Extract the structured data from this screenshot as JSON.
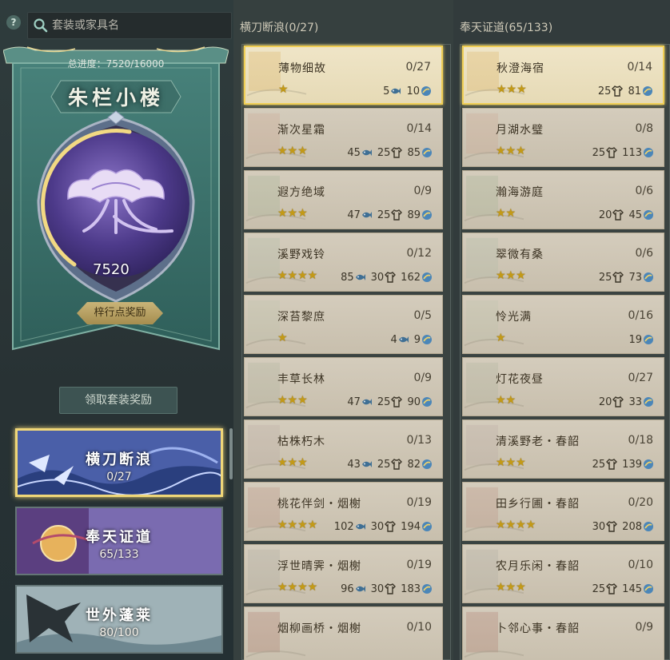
{
  "search": {
    "placeholder": "套装或家具名"
  },
  "pavilion": {
    "progress_text": "总进度：7520/16000",
    "title": "朱栏小楼",
    "score": "7520",
    "reward_label": "梓行点奖励",
    "progress_fraction": 0.47
  },
  "collect_button": "领取套装奖励",
  "sets": [
    {
      "name": "横刀断浪",
      "count": "0/27",
      "active": true
    },
    {
      "name": "奉天证道",
      "count": "65/133",
      "active": false
    },
    {
      "name": "世外蓬莱",
      "count": "80/100",
      "active": false
    }
  ],
  "columns": [
    {
      "header": "横刀断浪(0/27)",
      "items": [
        {
          "name": "薄物细故",
          "count": "0/27",
          "stars": "★",
          "s1": "5",
          "s2": "",
          "s3": "10",
          "selected": true
        },
        {
          "name": "渐次星霜",
          "count": "0/14",
          "stars": "★★★",
          "s1": "45",
          "s2": "25",
          "s3": "85"
        },
        {
          "name": "遐方绝域",
          "count": "0/9",
          "stars": "★★★",
          "s1": "47",
          "s2": "25",
          "s3": "89"
        },
        {
          "name": "溪野戏铃",
          "count": "0/12",
          "stars": "★★★★",
          "s1": "85",
          "s2": "30",
          "s3": "162"
        },
        {
          "name": "深苔黎庶",
          "count": "0/5",
          "stars": "★",
          "s1": "4",
          "s2": "",
          "s3": "9"
        },
        {
          "name": "丰草长林",
          "count": "0/9",
          "stars": "★★★",
          "s1": "47",
          "s2": "25",
          "s3": "90"
        },
        {
          "name": "枯株朽木",
          "count": "0/13",
          "stars": "★★★",
          "s1": "43",
          "s2": "25",
          "s3": "82"
        },
        {
          "name": "桃花伴剑・烟榭",
          "count": "0/19",
          "stars": "★★★★",
          "s1": "102",
          "s2": "30",
          "s3": "194"
        },
        {
          "name": "浮世晴霁・烟榭",
          "count": "0/19",
          "stars": "★★★★",
          "s1": "96",
          "s2": "30",
          "s3": "183"
        },
        {
          "name": "烟柳画桥・烟榭",
          "count": "0/10",
          "stars": "",
          "s1": "",
          "s2": "",
          "s3": ""
        }
      ]
    },
    {
      "header": "奉天证道(65/133)",
      "items": [
        {
          "name": "秋澄海宿",
          "count": "0/14",
          "stars": "★★★",
          "s1": "",
          "s2": "25",
          "s3": "81",
          "selected": true
        },
        {
          "name": "月湖水璧",
          "count": "0/8",
          "stars": "★★★",
          "s1": "",
          "s2": "25",
          "s3": "113"
        },
        {
          "name": "瀚海游庭",
          "count": "0/6",
          "stars": "★★",
          "s1": "",
          "s2": "20",
          "s3": "45"
        },
        {
          "name": "翠微有桑",
          "count": "0/6",
          "stars": "★★★",
          "s1": "",
          "s2": "25",
          "s3": "73"
        },
        {
          "name": "怜光满",
          "count": "0/16",
          "stars": "★",
          "s1": "",
          "s2": "",
          "s3": "19"
        },
        {
          "name": "灯花夜昼",
          "count": "0/27",
          "stars": "★★",
          "s1": "",
          "s2": "20",
          "s3": "33"
        },
        {
          "name": "清溪野老・春韶",
          "count": "0/18",
          "stars": "★★★",
          "s1": "",
          "s2": "25",
          "s3": "139"
        },
        {
          "name": "田乡行圃・春韶",
          "count": "0/20",
          "stars": "★★★★",
          "s1": "",
          "s2": "30",
          "s3": "208"
        },
        {
          "name": "农月乐闲・春韶",
          "count": "0/10",
          "stars": "★★★",
          "s1": "",
          "s2": "25",
          "s3": "145"
        },
        {
          "name": "卜邻心事・春韶",
          "count": "0/9",
          "stars": "",
          "s1": "",
          "s2": "",
          "s3": ""
        }
      ]
    }
  ],
  "colors": {
    "gold": "#f0d778",
    "star": "#c39a17",
    "panel": "#3e6b66"
  }
}
